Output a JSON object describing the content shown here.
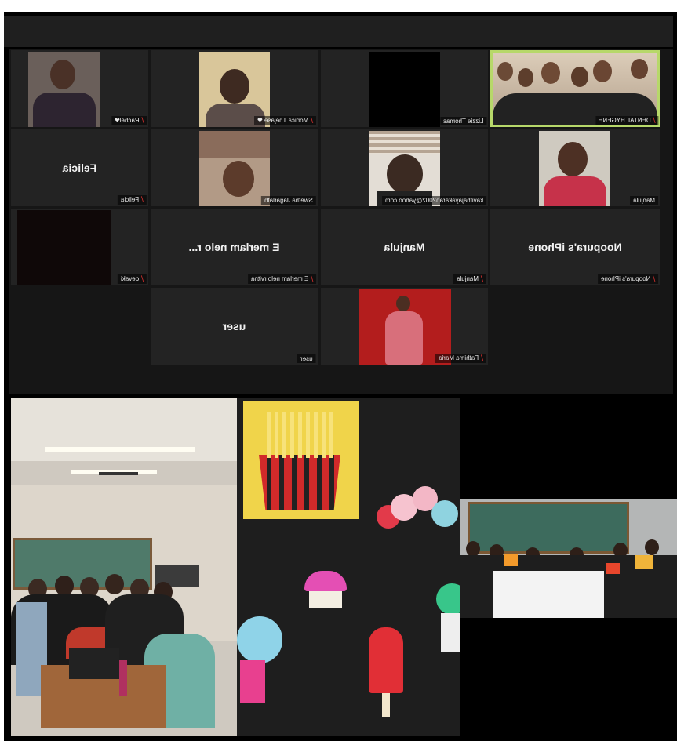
{
  "meeting": {
    "participants": [
      {
        "display": "",
        "label": "Rachel❤"
      },
      {
        "display": "",
        "label": "Monica Thejase ❤"
      },
      {
        "display": "",
        "label": "Lizzie Thomas"
      },
      {
        "display": "",
        "label": "DENTAL HYGENE"
      },
      {
        "display": "Felicia",
        "label": "Felicia"
      },
      {
        "display": "",
        "label": "Swetha Jagarlath"
      },
      {
        "display": "",
        "label": "kavithajayakaran2002@yahoo.com"
      },
      {
        "display": "",
        "label": "Manjula"
      },
      {
        "display": "",
        "label": "devaki"
      },
      {
        "display": "E merlam nelo r...",
        "label": "E merlam nelo rvitna"
      },
      {
        "display": "Manjula",
        "label": "Manjula"
      },
      {
        "display": "Noopura's iPhone",
        "label": "Noopura's iPhone"
      },
      {
        "display": "user",
        "label": "user"
      },
      {
        "display": "",
        "label": "Fathima Maria"
      }
    ]
  },
  "icons": {
    "mic_muted": "mic-muted-icon",
    "mic_muted_glyph": "⧸"
  },
  "colors": {
    "active_speaker": "#b7d86a",
    "muted": "#e0312f"
  }
}
